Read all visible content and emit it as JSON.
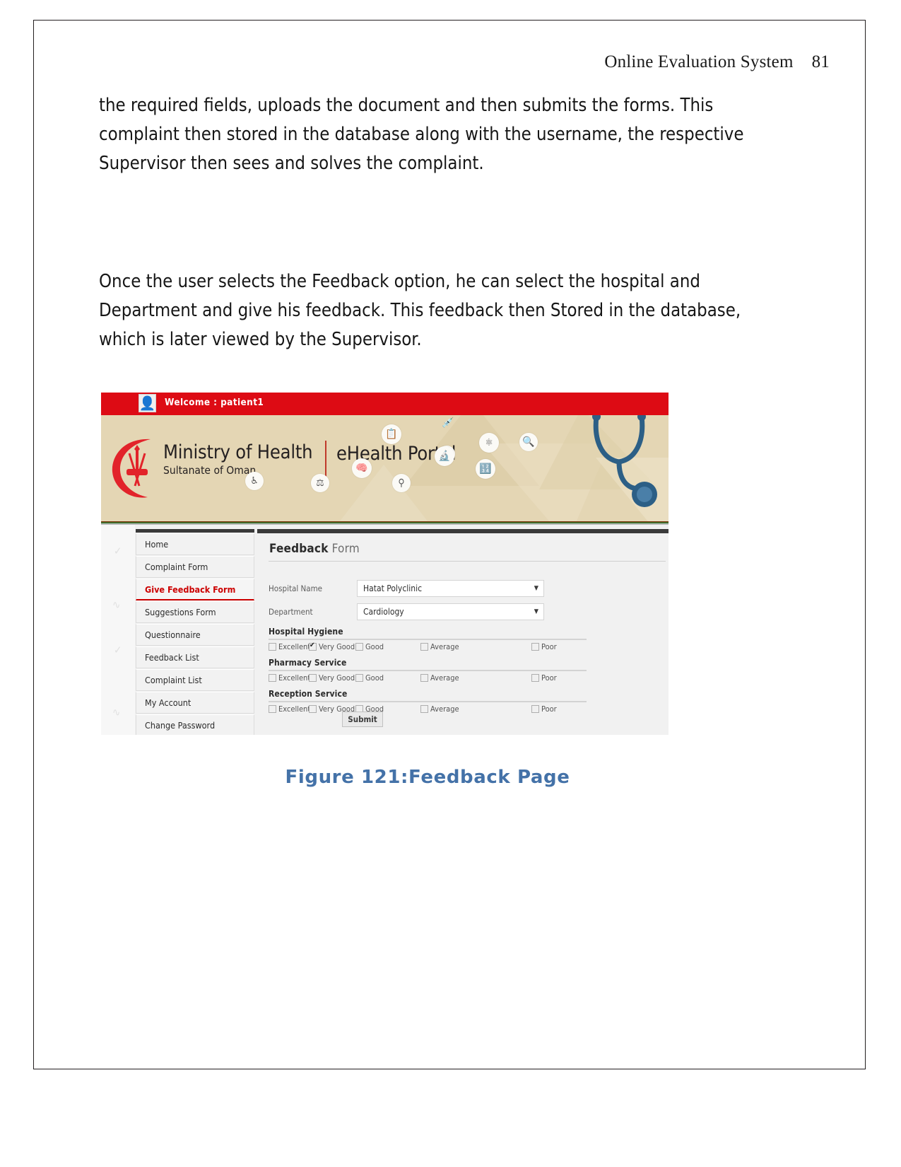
{
  "header": {
    "running_title": "Online Evaluation System",
    "page_number": "81"
  },
  "document": {
    "paragraph_1": "the required fields, uploads the document and then submits the forms. This complaint then stored in the database along with the username, the respective Supervisor then sees and solves the complaint.",
    "paragraph_2": "Once the user selects the Feedback option, he can select the hospital and Department and give his feedback. This feedback then Stored in the database, which is later viewed by the Supervisor.",
    "figure_caption": "Figure 121:Feedback Page"
  },
  "screenshot": {
    "topbar": {
      "welcome_text": "Welcome : patient1",
      "avatar_icon": "user-icon"
    },
    "banner": {
      "ministry_line1": "Ministry of Health",
      "ministry_line2": "Sultanate of Oman",
      "portal_name": "eHealth Portal",
      "emblem_icon": "oman-national-emblem",
      "stethoscope_icon": "stethoscope-icon",
      "decor_icons": [
        "clipboard-icon",
        "syringe-icon",
        "atom-icon",
        "dna-icon",
        "brain-icon",
        "flask-icon",
        "magnifier-icon",
        "wheelchair-icon",
        "molecule-icon",
        "bandage-icon",
        "barcode-icon"
      ]
    },
    "sidebar": {
      "items": [
        {
          "label": "Home",
          "active": false
        },
        {
          "label": "Complaint Form",
          "active": false
        },
        {
          "label": "Give Feedback Form",
          "active": true
        },
        {
          "label": "Suggestions Form",
          "active": false
        },
        {
          "label": "Questionnaire",
          "active": false
        },
        {
          "label": "Feedback List",
          "active": false
        },
        {
          "label": "Complaint List",
          "active": false
        },
        {
          "label": "My Account",
          "active": false
        },
        {
          "label": "Change Password",
          "active": false
        }
      ]
    },
    "form": {
      "title_strong": "Feedback",
      "title_light": " Form",
      "fields": [
        {
          "label": "Hospital Name",
          "value": "Hatat Polyclinic"
        },
        {
          "label": "Department",
          "value": "Cardiology"
        }
      ],
      "rating_groups": [
        {
          "title": "Hospital Hygiene",
          "options": [
            {
              "label": "Excellent",
              "checked": false
            },
            {
              "label": "Very Good",
              "checked": true
            },
            {
              "label": "Good",
              "checked": false
            },
            {
              "label": "Average",
              "checked": false
            },
            {
              "label": "Poor",
              "checked": false
            }
          ]
        },
        {
          "title": "Pharmacy Service",
          "options": [
            {
              "label": "Excellent",
              "checked": false
            },
            {
              "label": "Very Good",
              "checked": false
            },
            {
              "label": "Good",
              "checked": false
            },
            {
              "label": "Average",
              "checked": false
            },
            {
              "label": "Poor",
              "checked": false
            }
          ]
        },
        {
          "title": "Reception Service",
          "options": [
            {
              "label": "Excellent",
              "checked": false
            },
            {
              "label": "Very Good",
              "checked": false
            },
            {
              "label": "Good",
              "checked": false
            },
            {
              "label": "Average",
              "checked": false
            },
            {
              "label": "Poor",
              "checked": false
            }
          ]
        }
      ],
      "submit_label": "Submit",
      "dropdown_caret": "▼"
    },
    "colors": {
      "topbar_red": "#dd0b14",
      "banner_beige": "#e4d6b4",
      "active_menu_red": "#cc0000",
      "caption_blue": "#4472a8"
    }
  }
}
